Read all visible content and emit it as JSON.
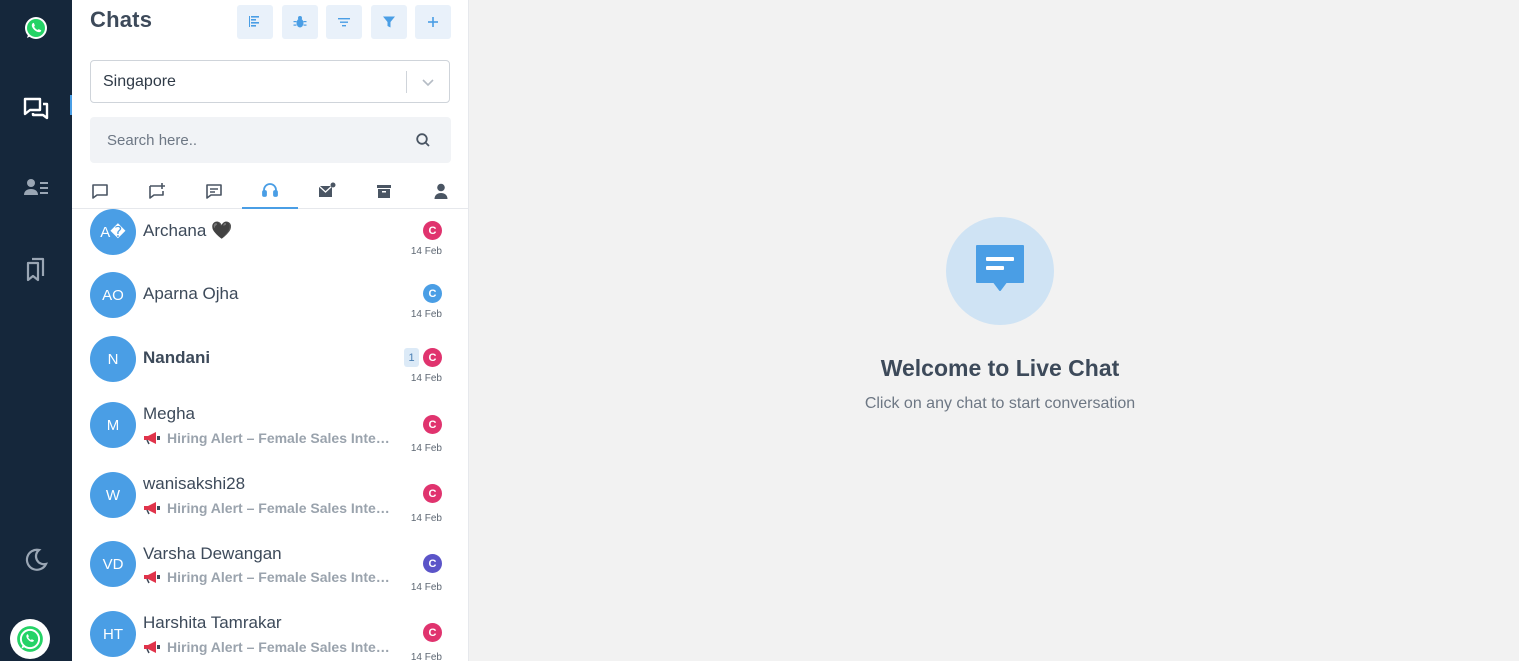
{
  "app": {
    "rail": {
      "items": [
        {
          "id": "whatsapp",
          "icon": "whatsapp-icon"
        },
        {
          "id": "chats",
          "icon": "chat-bubbles-icon",
          "active": true
        },
        {
          "id": "contacts",
          "icon": "contacts-icon"
        },
        {
          "id": "bookmarks",
          "icon": "bookmarks-icon"
        },
        {
          "id": "theme",
          "icon": "moon-icon"
        },
        {
          "id": "profile",
          "icon": "whatsapp-avatar-icon"
        }
      ]
    },
    "colors": {
      "rail_bg": "#15273b",
      "accent": "#4a9ee5",
      "badge_pink": "#e0336e",
      "badge_blue": "#4a9ee5",
      "badge_purple": "#5b54c8"
    }
  },
  "panel": {
    "title": "Chats",
    "toolbar": [
      {
        "id": "align",
        "icon": "align-left-icon"
      },
      {
        "id": "bug",
        "icon": "bug-icon"
      },
      {
        "id": "sort",
        "icon": "sort-icon"
      },
      {
        "id": "filter",
        "icon": "funnel-icon"
      },
      {
        "id": "add",
        "icon": "plus-icon"
      }
    ],
    "location_select": {
      "value": "Singapore"
    },
    "search": {
      "placeholder": "Search here.."
    },
    "tabs": [
      {
        "id": "chat",
        "icon": "chat-square-icon"
      },
      {
        "id": "chat-add",
        "icon": "chat-plus-icon"
      },
      {
        "id": "message",
        "icon": "message-lines-icon"
      },
      {
        "id": "support",
        "icon": "headset-icon",
        "active": true
      },
      {
        "id": "mail",
        "icon": "mail-icon"
      },
      {
        "id": "archive",
        "icon": "archive-icon"
      },
      {
        "id": "user",
        "icon": "user-icon"
      }
    ],
    "chats": [
      {
        "initials": "A�",
        "name": "Archana 🖤",
        "preview": "",
        "date": "14 Feb",
        "badge": "C",
        "badge_color": "#e0336e",
        "unread": "",
        "bold": false
      },
      {
        "initials": "AO",
        "name": "Aparna Ojha",
        "preview": "",
        "date": "14 Feb",
        "badge": "C",
        "badge_color": "#4a9ee5",
        "unread": "",
        "bold": false
      },
      {
        "initials": "N",
        "name": "Nandani",
        "preview": "",
        "date": "14 Feb",
        "badge": "C",
        "badge_color": "#e0336e",
        "unread": "1",
        "bold": true
      },
      {
        "initials": "M",
        "name": "Megha",
        "preview": "Hiring Alert – Female Sales Internship",
        "date": "14 Feb",
        "badge": "C",
        "badge_color": "#e0336e",
        "unread": "",
        "bold": false
      },
      {
        "initials": "W",
        "name": "wanisakshi28",
        "preview": "Hiring Alert – Female Sales Internship",
        "date": "14 Feb",
        "badge": "C",
        "badge_color": "#e0336e",
        "unread": "",
        "bold": false
      },
      {
        "initials": "VD",
        "name": "Varsha Dewangan",
        "preview": "Hiring Alert – Female Sales Internship",
        "date": "14 Feb",
        "badge": "C",
        "badge_color": "#5b54c8",
        "unread": "",
        "bold": false
      },
      {
        "initials": "HT",
        "name": "Harshita Tamrakar",
        "preview": "Hiring Alert – Female Sales Internship",
        "date": "14 Feb",
        "badge": "C",
        "badge_color": "#e0336e",
        "unread": "",
        "bold": false
      }
    ]
  },
  "welcome": {
    "icon": "chat-message-icon",
    "title": "Welcome to Live Chat",
    "subtitle": "Click on any chat to start conversation"
  }
}
